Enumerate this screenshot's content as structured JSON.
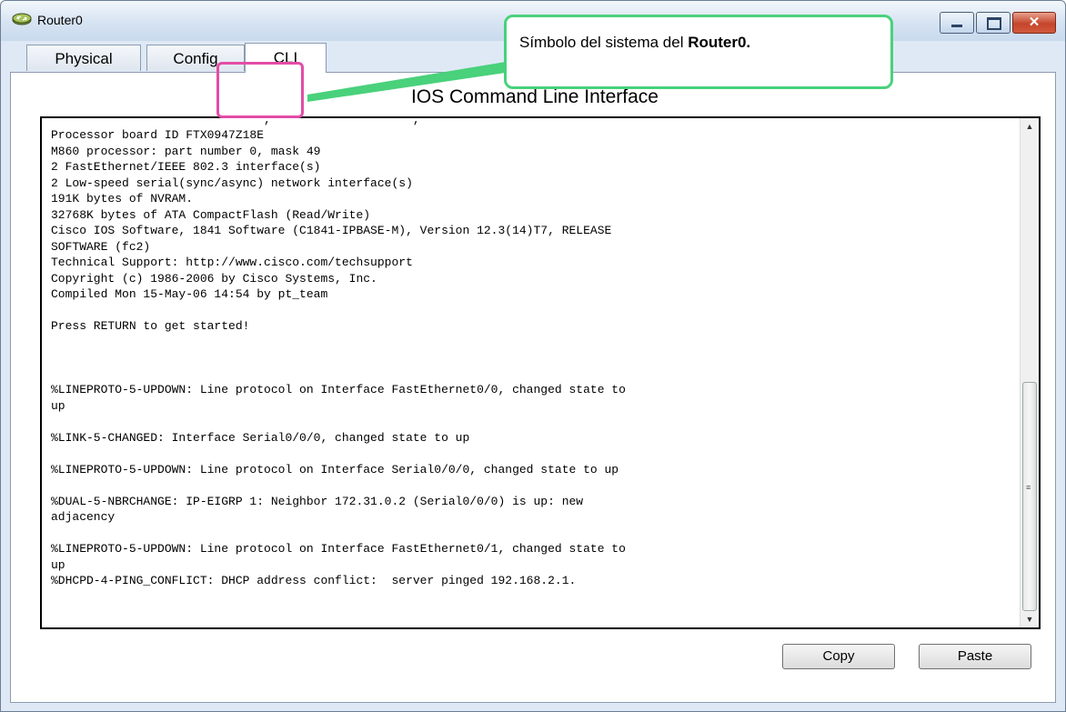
{
  "window": {
    "title": "Router0",
    "app_icon": "router-icon",
    "controls": {
      "minimize": "–",
      "maximize": "□",
      "close": "✕"
    }
  },
  "tabs": [
    {
      "label": "Physical",
      "active": false
    },
    {
      "label": "Config",
      "active": false
    },
    {
      "label": "CLI",
      "active": true
    }
  ],
  "cli": {
    "title": "IOS Command Line Interface",
    "clipped_top_line": "                              ,                    ,",
    "lines": [
      "Processor board ID FTX0947Z18E",
      "M860 processor: part number 0, mask 49",
      "2 FastEthernet/IEEE 802.3 interface(s)",
      "2 Low-speed serial(sync/async) network interface(s)",
      "191K bytes of NVRAM.",
      "32768K bytes of ATA CompactFlash (Read/Write)",
      "Cisco IOS Software, 1841 Software (C1841-IPBASE-M), Version 12.3(14)T7, RELEASE",
      "SOFTWARE (fc2)",
      "Technical Support: http://www.cisco.com/techsupport",
      "Copyright (c) 1986-2006 by Cisco Systems, Inc.",
      "Compiled Mon 15-May-06 14:54 by pt_team",
      "",
      "Press RETURN to get started!",
      "",
      "",
      "",
      "%LINEPROTO-5-UPDOWN: Line protocol on Interface FastEthernet0/0, changed state to",
      "up",
      "",
      "%LINK-5-CHANGED: Interface Serial0/0/0, changed state to up",
      "",
      "%LINEPROTO-5-UPDOWN: Line protocol on Interface Serial0/0/0, changed state to up",
      "",
      "%DUAL-5-NBRCHANGE: IP-EIGRP 1: Neighbor 172.31.0.2 (Serial0/0/0) is up: new",
      "adjacency",
      "",
      "%LINEPROTO-5-UPDOWN: Line protocol on Interface FastEthernet0/1, changed state to",
      "up",
      "%DHCPD-4-PING_CONFLICT: DHCP address conflict:  server pinged 192.168.2.1."
    ]
  },
  "buttons": {
    "copy": "Copy",
    "paste": "Paste"
  },
  "annotation": {
    "text_prefix": "Símbolo del sistema del ",
    "text_bold": "Router0."
  },
  "colors": {
    "callout_border": "#49d17b",
    "highlight_border": "#e44ca6"
  }
}
